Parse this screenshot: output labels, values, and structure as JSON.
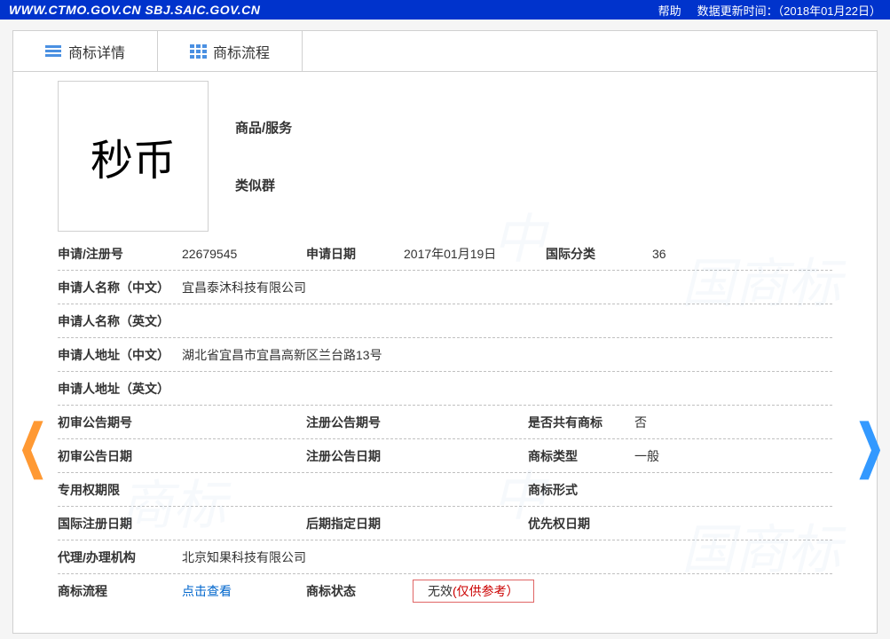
{
  "header": {
    "url": "WWW.CTMO.GOV.CN SBJ.SAIC.GOV.CN",
    "help": "帮助",
    "update_label": "数据更新时间：",
    "update_time": "（2018年01月22日）"
  },
  "tabs": {
    "details": "商标详情",
    "process": "商标流程"
  },
  "top": {
    "logo_text": "秒币",
    "goods_label": "商品/服务",
    "similar_label": "类似群"
  },
  "rows": {
    "reg_no_label": "申请/注册号",
    "reg_no": "22679545",
    "app_date_label": "申请日期",
    "app_date": "2017年01月19日",
    "intl_class_label": "国际分类",
    "intl_class": "36",
    "applicant_cn_label": "申请人名称（中文）",
    "applicant_cn": "宜昌泰沐科技有限公司",
    "applicant_en_label": "申请人名称（英文）",
    "applicant_en": "",
    "addr_cn_label": "申请人地址（中文）",
    "addr_cn": "湖北省宜昌市宜昌高新区兰台路13号",
    "addr_en_label": "申请人地址（英文）",
    "addr_en": "",
    "prelim_no_label": "初审公告期号",
    "prelim_no": "",
    "reg_ann_no_label": "注册公告期号",
    "reg_ann_no": "",
    "shared_label": "是否共有商标",
    "shared": "否",
    "prelim_date_label": "初审公告日期",
    "reg_ann_date_label": "注册公告日期",
    "tm_type_label": "商标类型",
    "tm_type": "一般",
    "excl_period_label": "专用权期限",
    "tm_form_label": "商标形式",
    "intl_reg_date_label": "国际注册日期",
    "later_date_label": "后期指定日期",
    "priority_date_label": "优先权日期",
    "agent_label": "代理/办理机构",
    "agent": "北京知果科技有限公司",
    "process_label": "商标流程",
    "process_link": "点击查看",
    "status_label": "商标状态",
    "status_val": "无效",
    "status_note": "(仅供参考）"
  },
  "watermarks": {
    "w1": "中",
    "w2": "国商标",
    "w3": "商标",
    "w4": "中",
    "w5": "国商标"
  }
}
